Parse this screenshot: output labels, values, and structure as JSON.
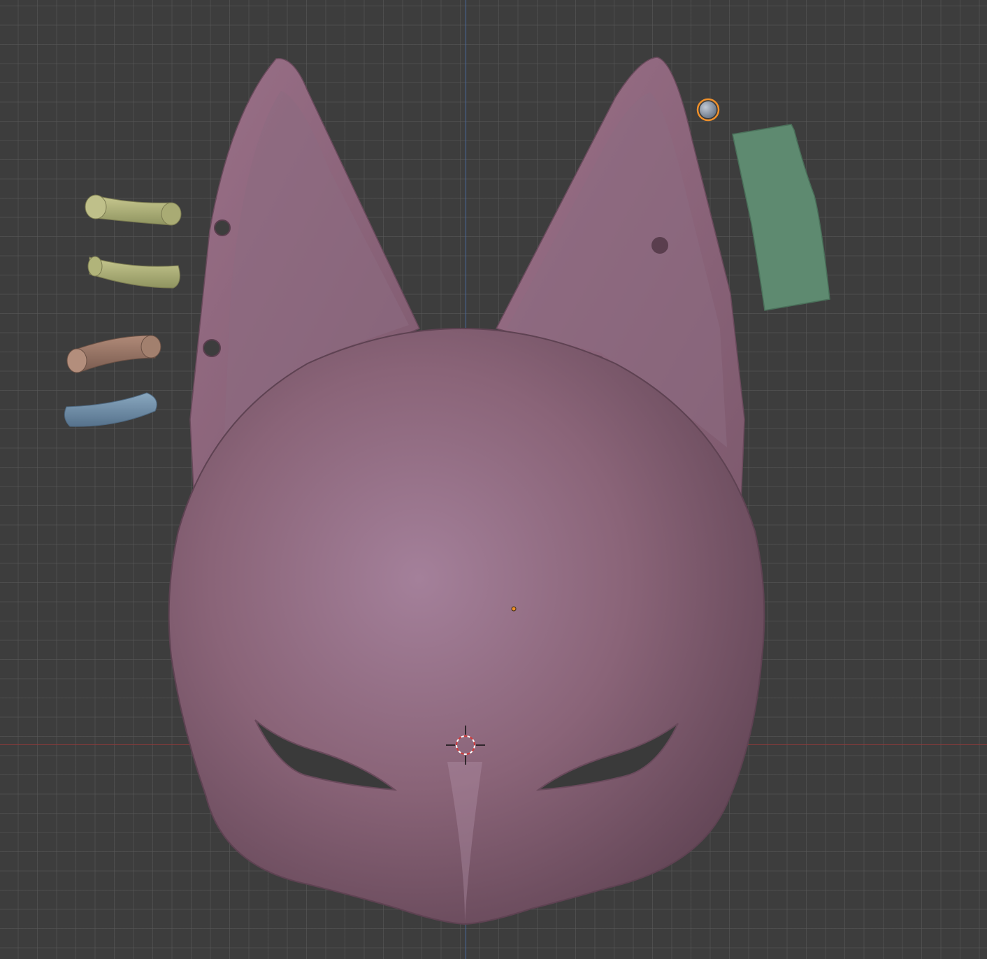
{
  "viewport": {
    "mode": "3D Viewport",
    "view": "front-orthographic",
    "grid": true,
    "background_color": "#3d3d3d",
    "axis_colors": {
      "x_axis": "#8a3a3a",
      "z_axis": "#4a6a9e"
    }
  },
  "scene": {
    "objects": [
      {
        "name": "fox-mask",
        "color": "#8c6478",
        "selected": false
      },
      {
        "name": "cylinder-yellow-1",
        "color": "#b9b77a",
        "selected": false
      },
      {
        "name": "cylinder-yellow-2",
        "color": "#a8b074",
        "selected": false
      },
      {
        "name": "cylinder-brown",
        "color": "#9a7a6a",
        "selected": false
      },
      {
        "name": "cylinder-blue",
        "color": "#6f8fa8",
        "selected": false
      },
      {
        "name": "sphere-small",
        "color": "#8a96a6",
        "selected": true
      },
      {
        "name": "plane-green",
        "color": "#5e8a70",
        "selected": false
      }
    ],
    "selection_outline_color": "#f0902a",
    "cursor": "3d-cursor",
    "origin_marker": "object-origin"
  }
}
